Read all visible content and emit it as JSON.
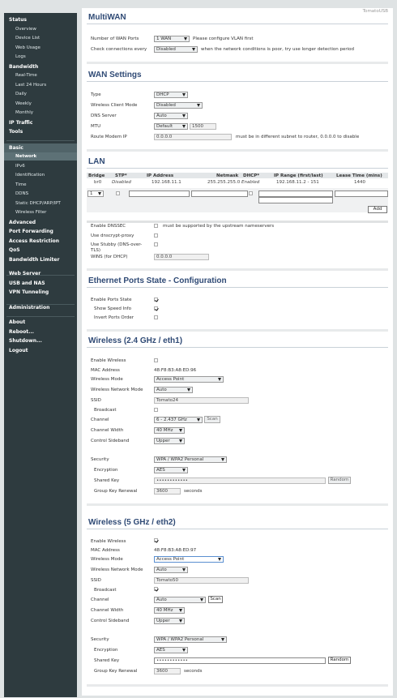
{
  "app": {
    "hostname": "TomatoUSB"
  },
  "sidebar": {
    "items": [
      {
        "label": "Status",
        "sub": false
      },
      {
        "label": "Overview",
        "sub": true
      },
      {
        "label": "Device List",
        "sub": true
      },
      {
        "label": "Web Usage",
        "sub": true
      },
      {
        "label": "Logs",
        "sub": true
      },
      {
        "label": "Bandwidth",
        "sub": false
      },
      {
        "label": "Real-Time",
        "sub": true
      },
      {
        "label": "Last 24 Hours",
        "sub": true
      },
      {
        "label": "Daily",
        "sub": true
      },
      {
        "label": "Weekly",
        "sub": true
      },
      {
        "label": "Monthly",
        "sub": true
      },
      {
        "label": "IP Traffic",
        "sub": false
      },
      {
        "label": "Tools",
        "sub": false
      },
      {
        "label": "Basic",
        "sub": false
      },
      {
        "label": "Network",
        "sub": true
      },
      {
        "label": "IPv6",
        "sub": true
      },
      {
        "label": "Identification",
        "sub": true
      },
      {
        "label": "Time",
        "sub": true
      },
      {
        "label": "DDNS",
        "sub": true
      },
      {
        "label": "Static DHCP/ARP/IPT",
        "sub": true
      },
      {
        "label": "Wireless Filter",
        "sub": true
      },
      {
        "label": "Advanced",
        "sub": false
      },
      {
        "label": "Port Forwarding",
        "sub": false
      },
      {
        "label": "Access Restriction",
        "sub": false
      },
      {
        "label": "QoS",
        "sub": false
      },
      {
        "label": "Bandwidth Limiter",
        "sub": false
      },
      {
        "label": "Web Server",
        "sub": false
      },
      {
        "label": "USB and NAS",
        "sub": false
      },
      {
        "label": "VPN Tunneling",
        "sub": false
      },
      {
        "label": "Administration",
        "sub": false
      },
      {
        "label": "About",
        "sub": false
      },
      {
        "label": "Reboot...",
        "sub": false
      },
      {
        "label": "Shutdown...",
        "sub": false
      },
      {
        "label": "Logout",
        "sub": false
      }
    ]
  },
  "multiwan": {
    "title": "MultiWAN",
    "wan_ports_label": "Number of WAN Ports",
    "wan_ports_value": "1 WAN",
    "wan_ports_note": "Please configure VLAN first",
    "check_label": "Check connections every",
    "check_value": "Disabled",
    "check_note": "when the network conditions is poor, try use longer detection period"
  },
  "wan": {
    "title": "WAN Settings",
    "type_label": "Type",
    "type_value": "DHCP",
    "wcm_label": "Wireless Client Mode",
    "wcm_value": "Disabled",
    "dns_label": "DNS Server",
    "dns_value": "Auto",
    "mtu_label": "MTU",
    "mtu_mode": "Default",
    "mtu_value": "1500",
    "modem_label": "Route Modem IP",
    "modem_value": "0.0.0.0",
    "modem_note": "must be in different subnet to router, 0.0.0.0 to disable"
  },
  "lan": {
    "title": "LAN",
    "headers": [
      "Bridge",
      "STP*",
      "IP Address",
      "Netmask",
      "DHCP*",
      "IP Range (first/last)",
      "Lease Time (mins)"
    ],
    "row": {
      "bridge": "br0",
      "stp": "Disabled",
      "ip": "192.168.11.1",
      "netmask": "255.255.255.0",
      "dhcp": "Enabled",
      "range": "192.168.11.2 - 151",
      "lease": "1440"
    },
    "edit_bridge": "1",
    "add_label": "Add",
    "dnssec_label": "Enable DNSSEC",
    "dnssec_note": "must be supported by the upstream nameservers",
    "dnscrypt_label": "Use dnscrypt-proxy",
    "stubby_label": "Use Stubby (DNS-over-TLS)",
    "wins_label": "WINS (for DHCP)",
    "wins_value": "0.0.0.0"
  },
  "eth": {
    "title": "Ethernet Ports State - Configuration",
    "enable_label": "Enable Ports State",
    "speed_label": "Show Speed Info",
    "invert_label": "Invert Ports Order"
  },
  "w24": {
    "title": "Wireless (2.4 GHz / eth1)",
    "enable_label": "Enable Wireless",
    "mac_label": "MAC Address",
    "mac_value": "48:F8:B3:A8:ED:96",
    "mode_label": "Wireless Mode",
    "mode_value": "Access Point",
    "netmode_label": "Wireless Network Mode",
    "netmode_value": "Auto",
    "ssid_label": "SSID",
    "ssid_value": "Tomato24",
    "broadcast_label": "Broadcast",
    "channel_label": "Channel",
    "channel_value": "6 - 2.437 GHz",
    "scan_label": "Scan",
    "width_label": "Channel Width",
    "width_value": "40 MHz",
    "sideband_label": "Control Sideband",
    "sideband_value": "Upper",
    "security_label": "Security",
    "security_value": "WPA / WPA2 Personal",
    "enc_label": "Encryption",
    "enc_value": "AES",
    "key_label": "Shared Key",
    "key_value": "••••••••••••",
    "random_label": "Random",
    "renewal_label": "Group Key Renewal",
    "renewal_value": "3600",
    "renewal_unit": "seconds"
  },
  "w5": {
    "title": "Wireless (5 GHz / eth2)",
    "enable_label": "Enable Wireless",
    "mac_label": "MAC Address",
    "mac_value": "48:F8:B3:A8:ED:97",
    "mode_label": "Wireless Mode",
    "mode_value": "Access Point",
    "netmode_label": "Wireless Network Mode",
    "netmode_value": "Auto",
    "ssid_label": "SSID",
    "ssid_value": "Tomato50",
    "broadcast_label": "Broadcast",
    "channel_label": "Channel",
    "channel_value": "Auto",
    "scan_label": "Scan",
    "width_label": "Channel Width",
    "width_value": "40 MHz",
    "sideband_label": "Control Sideband",
    "sideband_value": "Upper",
    "security_label": "Security",
    "security_value": "WPA / WPA2 Personal",
    "enc_label": "Encryption",
    "enc_value": "AES",
    "key_label": "Shared Key",
    "key_value": "••••••••••••",
    "random_label": "Random",
    "renewal_label": "Group Key Renewal",
    "renewal_value": "3600",
    "renewal_unit": "seconds"
  }
}
